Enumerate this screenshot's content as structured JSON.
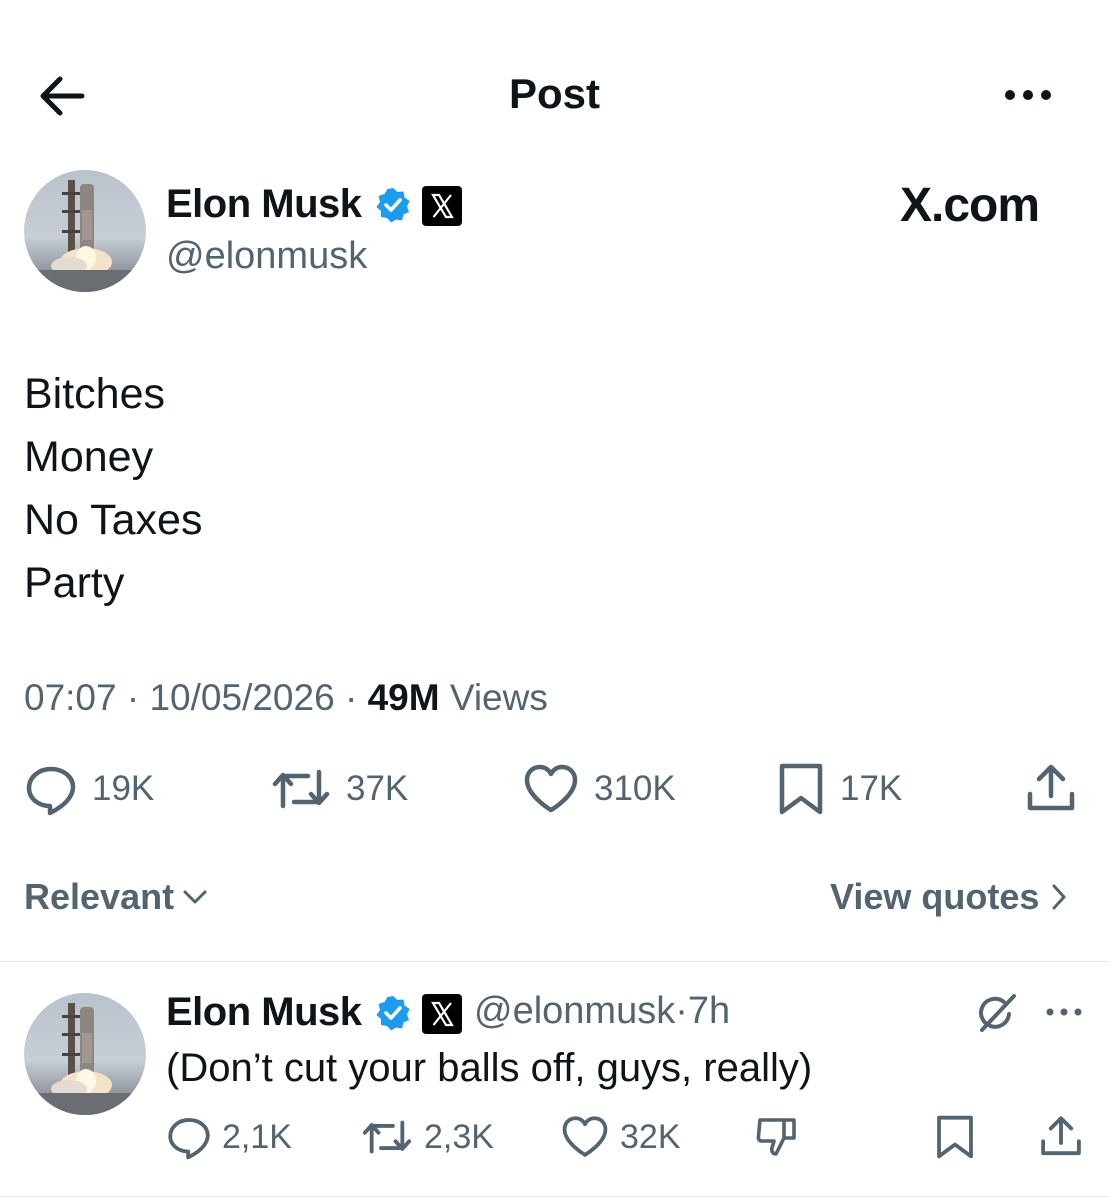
{
  "header": {
    "title": "Post"
  },
  "post": {
    "author_name": "Elon Musk",
    "author_handle": "@elonmusk",
    "brand_text": "X.com",
    "lines": [
      "Bitches",
      "Money",
      "No Taxes",
      "Party"
    ],
    "time": "07:07",
    "date": "10/05/2026",
    "views_count": "49M",
    "views_label": "Views",
    "stats": {
      "replies": "19K",
      "reposts": "37K",
      "likes": "310K",
      "bookmarks": "17K"
    }
  },
  "sort": {
    "label": "Relevant",
    "view_quotes": "View quotes"
  },
  "reply": {
    "author_name": "Elon Musk",
    "handle": "@elonmusk",
    "time": "7h",
    "text": "(Don’t cut your balls off, guys, really)",
    "stats": {
      "replies": "2,1K",
      "reposts": "2,3K",
      "likes": "32K"
    }
  },
  "colors": {
    "text": "#0f1419",
    "muted": "#536471",
    "verified": "#1d9bf0",
    "divider": "#e3e7ea"
  },
  "icons": [
    "back-arrow-icon",
    "more-icon",
    "verified-icon",
    "x-logo-icon",
    "reply-icon",
    "repost-icon",
    "like-icon",
    "bookmark-icon",
    "share-icon",
    "chevron-down-icon",
    "chevron-right-icon",
    "grok-icon",
    "dislike-icon"
  ]
}
